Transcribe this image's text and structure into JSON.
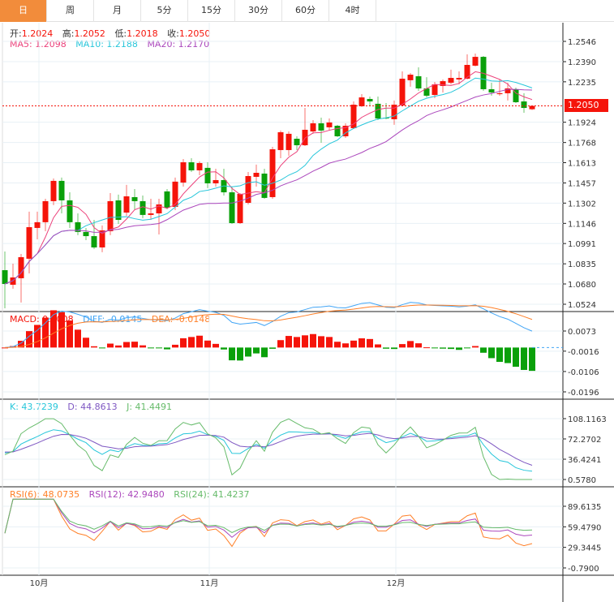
{
  "tabs": [
    "日",
    "周",
    "月",
    "5分",
    "15分",
    "30分",
    "60分",
    "4时"
  ],
  "active_tab": 0,
  "ohlc_header": {
    "open_label": "开:",
    "open": "1.2024",
    "high_label": "高:",
    "high": "1.2052",
    "low_label": "低:",
    "low": "1.2018",
    "close_label": "收:",
    "close": "1.2050"
  },
  "ma_header": {
    "ma5": "MA5: 1.2098",
    "ma10": "MA10: 1.2188",
    "ma20": "MA20: 1.2170"
  },
  "macd_header": {
    "macd": "MACD: 0.0008",
    "diff": "DIFF: -0.0145",
    "dea": "DEA: -0.0148"
  },
  "kdj_header": {
    "k": "K: 43.7239",
    "d": "D: 44.8613",
    "j": "J: 41.4491"
  },
  "rsi_header": {
    "rsi6": "RSI(6): 48.0735",
    "rsi12": "RSI(12): 42.9480",
    "rsi24": "RSI(24): 41.4237"
  },
  "current_price": "1.2050",
  "colors": {
    "up": "#f5140a",
    "down": "#0aa00a",
    "ma5": "#ec407a",
    "ma10": "#26c6da",
    "ma20": "#ab47bc",
    "diff": "#42a5f5",
    "dea": "#ff7f27",
    "k": "#26c6da",
    "d": "#7e57c2",
    "j": "#66bb6a",
    "rsi6": "#ff7f27",
    "rsi12": "#ab47bc",
    "rsi24": "#66bb6a",
    "tab_active": "#f28c3b"
  },
  "chart_data": {
    "type": "candlestick",
    "x_labels": [
      {
        "label": "10月",
        "index": 5
      },
      {
        "label": "11月",
        "index": 26
      },
      {
        "label": "12月",
        "index": 49
      }
    ],
    "price_axis": {
      "ticks": [
        "1.2546",
        "1.2390",
        "1.2235",
        "1.1924",
        "1.1768",
        "1.1613",
        "1.1457",
        "1.1302",
        "1.1146",
        "1.0991",
        "1.0835",
        "1.0680",
        "1.0524"
      ],
      "range": [
        1.0524,
        1.2546
      ]
    },
    "macd_axis": {
      "ticks": [
        "0.0073",
        "-0.0016",
        "-0.0106",
        "-0.0196"
      ],
      "range": [
        -0.0196,
        0.0073
      ]
    },
    "kdj_axis": {
      "ticks": [
        "108.1163",
        "72.2702",
        "36.4241",
        "0.5780"
      ],
      "range": [
        0.578,
        108.1163
      ]
    },
    "rsi_axis": {
      "ticks": [
        "89.6135",
        "59.4790",
        "29.3445",
        "-0.7900"
      ],
      "range": [
        -0.79,
        89.6135
      ]
    },
    "candles": [
      [
        1.0786,
        1.068,
        1.093,
        1.0493
      ],
      [
        1.0674,
        1.073,
        1.0836,
        1.0643
      ],
      [
        1.0724,
        1.0886,
        1.0911,
        1.0537
      ],
      [
        1.0874,
        1.1117,
        1.1236,
        1.0761
      ],
      [
        1.1111,
        1.1155,
        1.1236,
        1.1023
      ],
      [
        1.1155,
        1.1317,
        1.1335,
        1.1086
      ],
      [
        1.1317,
        1.1473,
        1.1491,
        1.1286
      ],
      [
        1.1473,
        1.1323,
        1.1498,
        1.1223
      ],
      [
        1.1323,
        1.1155,
        1.1385,
        1.1111
      ],
      [
        1.1155,
        1.108,
        1.1223,
        1.1055
      ],
      [
        1.108,
        1.1048,
        1.1111,
        1.1017
      ],
      [
        1.1048,
        1.0961,
        1.1173,
        1.0949
      ],
      [
        1.0961,
        1.1092,
        1.113,
        1.0924
      ],
      [
        1.1086,
        1.1317,
        1.1379,
        1.1055
      ],
      [
        1.1323,
        1.1173,
        1.1367,
        1.1142
      ],
      [
        1.1229,
        1.1354,
        1.1442,
        1.1204
      ],
      [
        1.1348,
        1.1317,
        1.141,
        1.1254
      ],
      [
        1.1317,
        1.1211,
        1.136,
        1.1186
      ],
      [
        1.1211,
        1.1223,
        1.1335,
        1.1173
      ],
      [
        1.1223,
        1.1292,
        1.1335,
        1.1061
      ],
      [
        1.1392,
        1.1267,
        1.141,
        1.1254
      ],
      [
        1.1273,
        1.1467,
        1.1498,
        1.1248
      ],
      [
        1.146,
        1.1616,
        1.1641,
        1.1429
      ],
      [
        1.1616,
        1.1554,
        1.1647,
        1.1541
      ],
      [
        1.1554,
        1.161,
        1.1623,
        1.1516
      ],
      [
        1.1573,
        1.1454,
        1.1616,
        1.1417
      ],
      [
        1.1454,
        1.1479,
        1.1566,
        1.1429
      ],
      [
        1.1479,
        1.1385,
        1.1566,
        1.136
      ],
      [
        1.1385,
        1.1148,
        1.1429,
        1.1142
      ],
      [
        1.1148,
        1.1373,
        1.1379,
        1.1142
      ],
      [
        1.1304,
        1.151,
        1.1541,
        1.1292
      ],
      [
        1.1504,
        1.1535,
        1.1598,
        1.1429
      ],
      [
        1.1529,
        1.1342,
        1.1566,
        1.1335
      ],
      [
        1.1348,
        1.1716,
        1.1735,
        1.1335
      ],
      [
        1.171,
        1.1847,
        1.186,
        1.1647
      ],
      [
        1.171,
        1.1835,
        1.1853,
        1.1666
      ],
      [
        1.1797,
        1.1747,
        1.1816,
        1.171
      ],
      [
        1.1747,
        1.1866,
        1.2034,
        1.1741
      ],
      [
        1.1853,
        1.1916,
        1.1941,
        1.1835
      ],
      [
        1.1916,
        1.186,
        1.1959,
        1.1766
      ],
      [
        1.1885,
        1.1922,
        1.1953,
        1.186
      ],
      [
        1.1897,
        1.1816,
        1.1904,
        1.181
      ],
      [
        1.1816,
        1.1897,
        1.1916,
        1.1803
      ],
      [
        1.1878,
        1.2059,
        1.2084,
        1.1872
      ],
      [
        1.2047,
        1.2115,
        1.214,
        1.2041
      ],
      [
        1.2103,
        1.2084,
        1.2122,
        1.2053
      ],
      [
        1.2066,
        1.1953,
        1.2122,
        1.1941
      ],
      [
        1.1959,
        1.1953,
        1.2072,
        1.1947
      ],
      [
        1.1947,
        1.2059,
        1.2091,
        1.1904
      ],
      [
        1.2053,
        1.2259,
        1.2315,
        1.2047
      ],
      [
        1.2247,
        1.229,
        1.2303,
        1.2197
      ],
      [
        1.2278,
        1.2184,
        1.2346,
        1.2165
      ],
      [
        1.2184,
        1.2128,
        1.2271,
        1.2115
      ],
      [
        1.2134,
        1.2215,
        1.2234,
        1.2109
      ],
      [
        1.2203,
        1.224,
        1.2253,
        1.2153
      ],
      [
        1.2228,
        1.2265,
        1.2328,
        1.2215
      ],
      [
        1.2253,
        1.2265,
        1.2315,
        1.2215
      ],
      [
        1.2259,
        1.2365,
        1.2446,
        1.2253
      ],
      [
        1.2359,
        1.2427,
        1.2452,
        1.2353
      ],
      [
        1.2427,
        1.2178,
        1.2434,
        1.2165
      ],
      [
        1.2178,
        1.2153,
        1.2228,
        1.2128
      ],
      [
        1.214,
        1.2147,
        1.2253,
        1.2128
      ],
      [
        1.2147,
        1.2184,
        1.2228,
        1.2091
      ],
      [
        1.2178,
        1.2078,
        1.219,
        1.2072
      ],
      [
        1.2084,
        1.2034,
        1.2147,
        1.1997
      ],
      [
        1.2024,
        1.205,
        1.2052,
        1.2018
      ]
    ]
  }
}
